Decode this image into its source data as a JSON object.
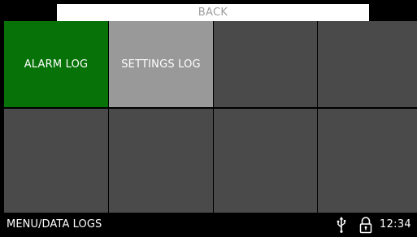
{
  "header": {
    "back_label": "BACK"
  },
  "tiles": [
    {
      "label": "ALARM LOG",
      "color": "#077208"
    },
    {
      "label": "SETTINGS LOG",
      "color": "#999999"
    },
    {
      "label": ""
    },
    {
      "label": ""
    },
    {
      "label": ""
    },
    {
      "label": ""
    },
    {
      "label": ""
    },
    {
      "label": ""
    }
  ],
  "status_bar": {
    "title": "MENU/DATA LOGS",
    "icons": [
      "usb-icon",
      "lock-icon"
    ],
    "time": "12:34"
  },
  "colors": {
    "background": "#000000",
    "tile_default": "#4a4a4a",
    "back_bar": "#ffffff",
    "back_text": "#9c9c9c"
  }
}
